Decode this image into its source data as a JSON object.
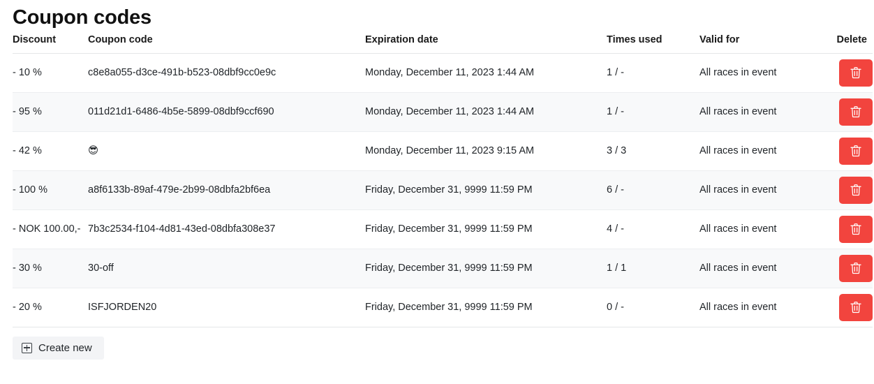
{
  "page": {
    "title": "Coupon codes"
  },
  "table": {
    "headers": {
      "discount": "Discount",
      "coupon_code": "Coupon code",
      "expiration_date": "Expiration date",
      "times_used": "Times used",
      "valid_for": "Valid for",
      "delete": "Delete"
    },
    "rows": [
      {
        "discount": "- 10 %",
        "coupon_code": "c8e8a055-d3ce-491b-b523-08dbf9cc0e9c",
        "expiration_date": "Monday, December 11, 2023 1:44 AM",
        "times_used": "1 / -",
        "valid_for": "All races in event",
        "delete_icon": "trash-icon"
      },
      {
        "discount": "- 95 %",
        "coupon_code": "011d21d1-6486-4b5e-5899-08dbf9ccf690",
        "expiration_date": "Monday, December 11, 2023 1:44 AM",
        "times_used": "1 / -",
        "valid_for": "All races in event",
        "delete_icon": "trash-icon"
      },
      {
        "discount": "- 42 %",
        "coupon_code": "😎",
        "expiration_date": "Monday, December 11, 2023 9:15 AM",
        "times_used": "3 / 3",
        "valid_for": "All races in event",
        "delete_icon": "trash-icon"
      },
      {
        "discount": "- 100 %",
        "coupon_code": "a8f6133b-89af-479e-2b99-08dbfa2bf6ea",
        "expiration_date": "Friday, December 31, 9999 11:59 PM",
        "times_used": "6 / -",
        "valid_for": "All races in event",
        "delete_icon": "trash-icon"
      },
      {
        "discount": "- NOK 100.00,-",
        "coupon_code": "7b3c2534-f104-4d81-43ed-08dbfa308e37",
        "expiration_date": "Friday, December 31, 9999 11:59 PM",
        "times_used": "4 / -",
        "valid_for": "All races in event",
        "delete_icon": "trash-icon"
      },
      {
        "discount": "- 30 %",
        "coupon_code": "30-off",
        "expiration_date": "Friday, December 31, 9999 11:59 PM",
        "times_used": "1 / 1",
        "valid_for": "All races in event",
        "delete_icon": "trash-icon"
      },
      {
        "discount": "- 20 %",
        "coupon_code": "ISFJORDEN20",
        "expiration_date": "Friday, December 31, 9999 11:59 PM",
        "times_used": "0 / -",
        "valid_for": "All races in event",
        "delete_icon": "trash-icon"
      }
    ]
  },
  "footer": {
    "create_new_label": "Create new",
    "create_new_icon": "plus-square-icon"
  },
  "colors": {
    "delete_button": "#f2443e",
    "row_alt_background": "#f8f9fa",
    "row_border": "#eceef0",
    "create_button_background": "#f3f4f6",
    "text": "#212529"
  }
}
